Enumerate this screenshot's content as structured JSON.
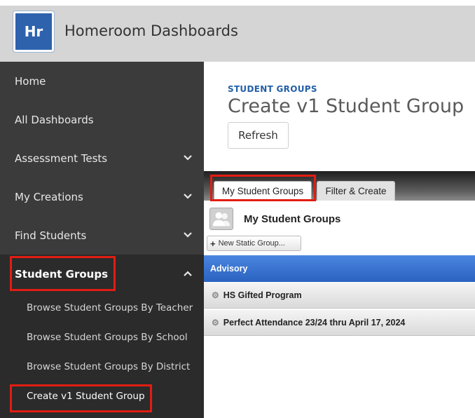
{
  "header": {
    "logo_text": "Hr",
    "app_title": "Homeroom Dashboards",
    "brand_color": "#2e62ad"
  },
  "sidebar": {
    "items": [
      {
        "label": "Home",
        "icon": ""
      },
      {
        "label": "All Dashboards",
        "icon": ""
      },
      {
        "label": "Assessment Tests",
        "icon": "chevron-down-icon"
      },
      {
        "label": "My Creations",
        "icon": "chevron-down-icon"
      },
      {
        "label": "Find Students",
        "icon": "chevron-down-icon"
      },
      {
        "label": "Student Groups",
        "icon": "chevron-up-icon"
      }
    ],
    "sub_items": [
      {
        "label": "Browse Student Groups By Teacher"
      },
      {
        "label": "Browse Student Groups By School"
      },
      {
        "label": "Browse Student Groups By District"
      },
      {
        "label": "Create v1 Student Group"
      }
    ]
  },
  "main": {
    "eyebrow": "STUDENT GROUPS",
    "title": "Create v1 Student Group",
    "refresh_label": "Refresh",
    "tabs": [
      {
        "label": "My Student Groups",
        "active": true
      },
      {
        "label": "Filter & Create",
        "active": false
      }
    ],
    "panel_title": "My Student Groups",
    "new_group_label": "New Static Group...",
    "groups": [
      {
        "label": "Advisory",
        "selected": true
      },
      {
        "label": "HS Gifted Program",
        "selected": false
      },
      {
        "label": "Perfect Attendance 23/24 thru April 17, 2024",
        "selected": false
      }
    ]
  },
  "colors": {
    "sidebar": "#3b3b3b",
    "sidebar_active": "#2b2b2b",
    "highlight_box": "#e11d12",
    "selected_row": "#2a62c0",
    "eyebrow": "#2360a8"
  }
}
